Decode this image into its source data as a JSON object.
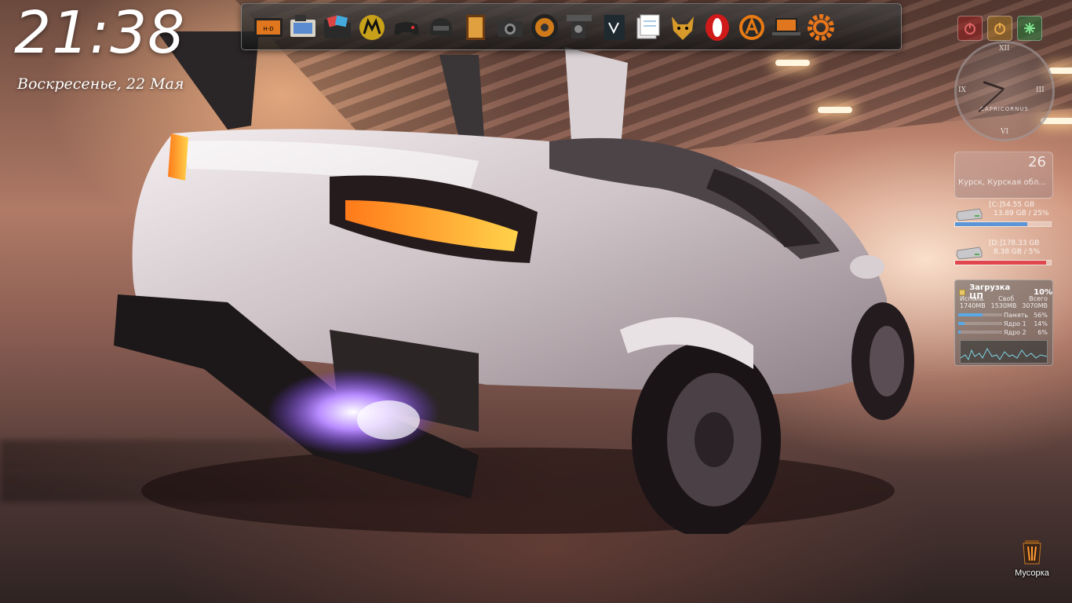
{
  "clock": {
    "time": "21:38",
    "date": "Воскресенье, 22 Мая"
  },
  "dock": {
    "items": [
      {
        "name": "harley-davidson-icon"
      },
      {
        "name": "camera-photos-icon"
      },
      {
        "name": "folder-icon"
      },
      {
        "name": "motorola-icon"
      },
      {
        "name": "gamepad-icon"
      },
      {
        "name": "helmet-icon"
      },
      {
        "name": "book-icon"
      },
      {
        "name": "camera-icon"
      },
      {
        "name": "speaker-icon"
      },
      {
        "name": "video-camera-icon"
      },
      {
        "name": "notebook-icon"
      },
      {
        "name": "documents-icon"
      },
      {
        "name": "fox-icon"
      },
      {
        "name": "opera-icon"
      },
      {
        "name": "avast-icon"
      },
      {
        "name": "harley-laptop-icon"
      },
      {
        "name": "settings-gear-icon"
      }
    ]
  },
  "analog_clock": {
    "twelve": "XII",
    "three": "III",
    "six": "VI",
    "nine": "IX",
    "zodiac": "CAPRICORNUS",
    "hour_value": 21,
    "minute_value": 38
  },
  "weather": {
    "temp": "26",
    "city": "Курск, Курская обл..."
  },
  "drives": [
    {
      "line1": "[C:]54.55 GB",
      "line2": "13.89 GB / 25%",
      "fill": 0.75,
      "color": "#5b95d6"
    },
    {
      "line1": "[D:]178.33 GB",
      "line2": "8.38 GB / 5%",
      "fill": 0.95,
      "color": "#e0464e"
    }
  ],
  "cpu": {
    "title": "Загрузка ЦП",
    "percent": "10%",
    "headers": [
      "Исполь",
      "Своб",
      "Всего"
    ],
    "values": [
      "1740MB",
      "1530MB",
      "3070MB"
    ],
    "rows": [
      {
        "label": "Память",
        "value": "56%",
        "fill": 0.56
      },
      {
        "label": "Ядро 1",
        "value": "14%",
        "fill": 0.14
      },
      {
        "label": "Ядро 2",
        "value": "6%",
        "fill": 0.06
      }
    ]
  },
  "recycle_bin": {
    "label": "Мусорка"
  }
}
